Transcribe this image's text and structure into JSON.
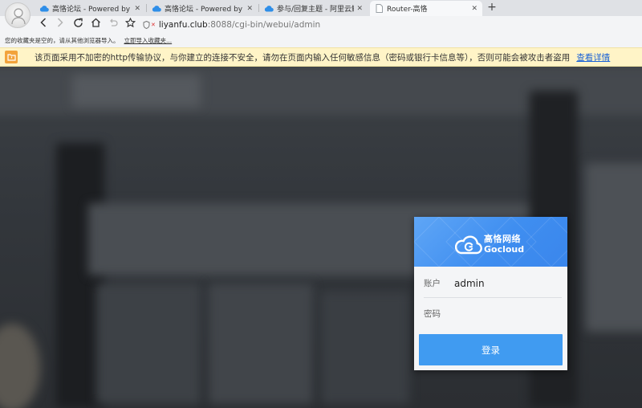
{
  "browser": {
    "tabs": [
      {
        "title": "高恪论坛 - Powered by Disc",
        "active": false,
        "favicon": "cloud-icon"
      },
      {
        "title": "高恪论坛 - Powered by Disc",
        "active": false,
        "favicon": "cloud-icon"
      },
      {
        "title": "参与/回复主题 - 阿里云解析问",
        "active": false,
        "favicon": "cloud-icon"
      },
      {
        "title": "Router-高恪",
        "active": true,
        "favicon": "page-icon"
      }
    ],
    "address": {
      "host": "liyanfu.club",
      "path": ":8088/cgi-bin/webui/admin"
    },
    "bookmarks": {
      "empty_text": "您的收藏夹是空的，请从其他浏览器导入。",
      "import_link": "立即导入收藏夹..."
    },
    "security_bar": {
      "message": "该页面采用不加密的http传输协议，与你建立的连接不安全，请勿在页面内输入任何敏感信息（密码或银行卡信息等），否则可能会被攻击者盗用",
      "details_link": "查看详情"
    }
  },
  "login": {
    "brand_cn": "高恪网络",
    "brand_en": "Gocloud",
    "account_label": "账户",
    "account_value": "admin",
    "password_label": "密码",
    "password_value": "",
    "submit_label": "登录"
  },
  "colors": {
    "accent": "#409bf1",
    "banner": "#3f8ef0",
    "warning_bg": "#fff4c7",
    "warning_icon": "#f2a33b",
    "link": "#1a62d6"
  }
}
